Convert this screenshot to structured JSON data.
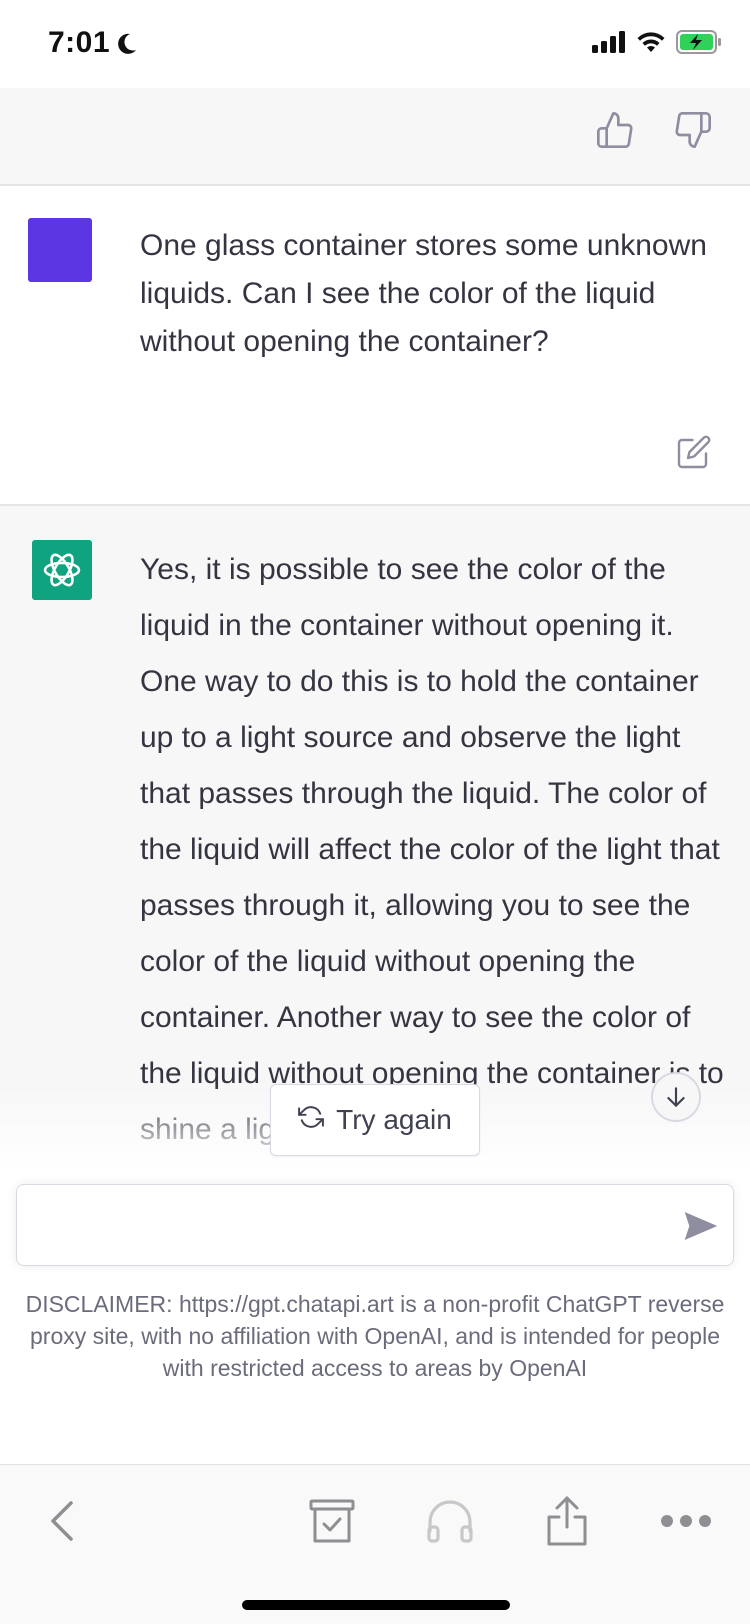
{
  "status_bar": {
    "time": "7:01"
  },
  "conversation": {
    "user_message": "One glass container stores some unknown liquids. Can I see the color of the liquid without opening the container?",
    "assistant_message": "Yes, it is possible to see the color of the liquid in the container without opening it. One way to do this is to hold the container up to a light source and observe the light that passes through the liquid. The color of the liquid will affect the color of the light that passes through it, allowing you to see the color of the liquid without opening the container. Another way to see the color of the liquid without opening the container is to shine a light on the"
  },
  "actions": {
    "try_again_label": "Try again"
  },
  "composer": {
    "placeholder": ""
  },
  "disclaimer": "DISCLAIMER: https://gpt.chatapi.art is a non-profit ChatGPT reverse proxy site, with no affiliation with OpenAI, and is intended for people with restricted access to areas by OpenAI",
  "colors": {
    "user_avatar": "#5b36e2",
    "assistant_avatar": "#10a37f",
    "battery_green": "#30d158"
  },
  "icons": {
    "thumbs_up": "thumbs-up-icon",
    "thumbs_down": "thumbs-down-icon",
    "edit": "edit-icon",
    "send": "send-icon",
    "back": "back-chevron-icon",
    "archive": "archive-check-icon",
    "headphones": "headphones-icon",
    "share": "share-icon",
    "more": "more-icon"
  }
}
